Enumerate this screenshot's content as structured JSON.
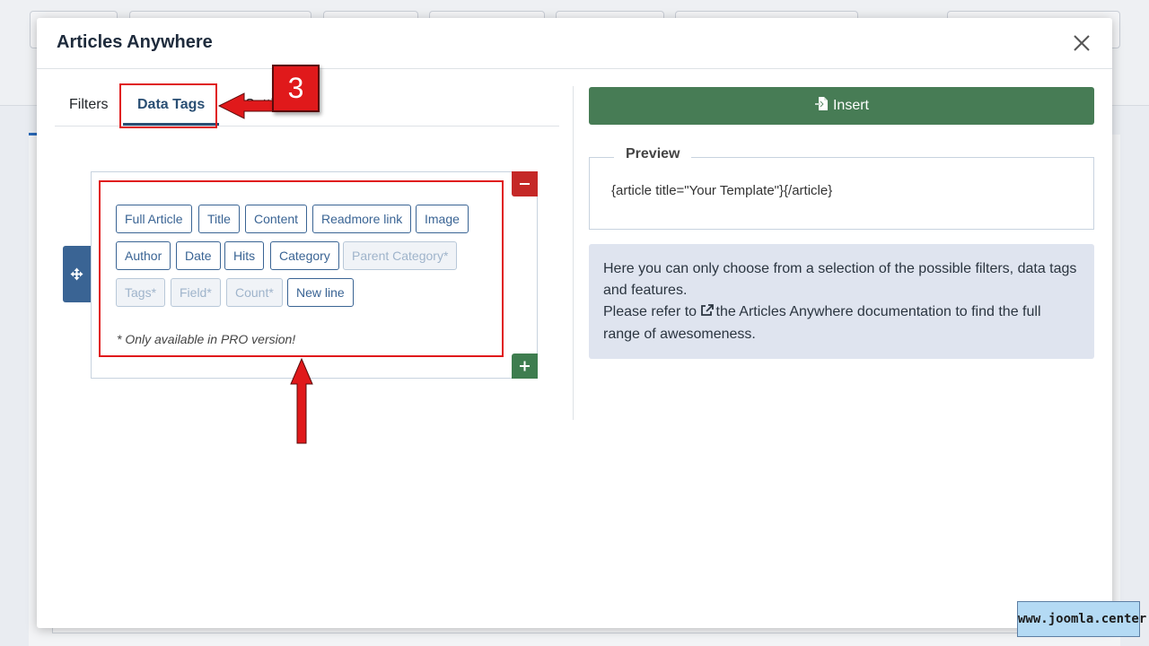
{
  "modal": {
    "title": "Articles Anywhere",
    "close_icon": "close-icon"
  },
  "tabs": [
    {
      "label": "Filters",
      "active": false
    },
    {
      "label": "Data Tags",
      "active": true
    },
    {
      "label": "Settings",
      "active": false
    }
  ],
  "data_tags": {
    "buttons": [
      {
        "label": "Full Article",
        "enabled": true
      },
      {
        "label": "Title",
        "enabled": true
      },
      {
        "label": "Content",
        "enabled": true
      },
      {
        "label": "Readmore link",
        "enabled": true
      },
      {
        "label": "Image",
        "enabled": true
      },
      {
        "label": "Author",
        "enabled": true
      },
      {
        "label": "Date",
        "enabled": true
      },
      {
        "label": "Hits",
        "enabled": true
      },
      {
        "label": "Category",
        "enabled": true
      },
      {
        "label": "Parent Category*",
        "enabled": false
      },
      {
        "label": "Tags*",
        "enabled": false
      },
      {
        "label": "Field*",
        "enabled": false
      },
      {
        "label": "Count*",
        "enabled": false
      },
      {
        "label": "New line",
        "enabled": true
      }
    ],
    "pro_note": "* Only available in PRO version!",
    "remove_icon": "minus-icon",
    "add_icon": "plus-icon",
    "drag_icon": "move-icon"
  },
  "annotation": {
    "step_number": "3",
    "color": "#e0191b"
  },
  "insert": {
    "label": "Insert",
    "icon": "file-import-icon",
    "color": "#477c55"
  },
  "preview": {
    "legend": "Preview",
    "code": "{article title=\"Your Template\"}{/article}"
  },
  "info": {
    "line1": "Here you can only choose from a selection of the possible filters, data tags and features.",
    "line2_prefix": "Please refer to ",
    "link_text": "the Articles Anywhere documentation",
    "line2_suffix": " to find the full range of awesomeness.",
    "link_icon": "external-link-icon"
  },
  "watermark": "www.joomla.center"
}
